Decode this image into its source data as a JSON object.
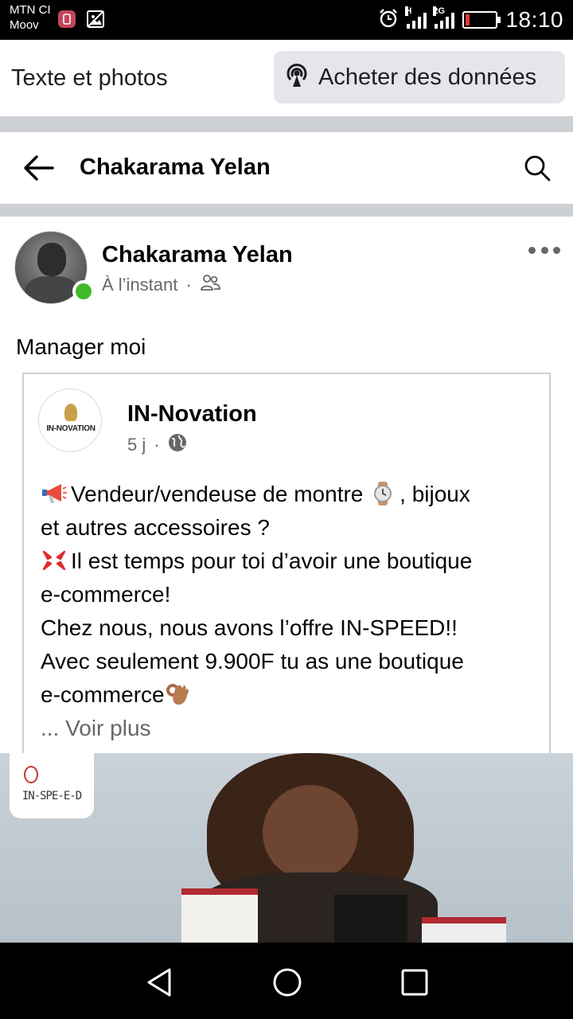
{
  "status_bar": {
    "carrier_1": "MTN CI",
    "carrier_2": "Moov",
    "network_1": "H",
    "network_2": "2G",
    "time": "18:10"
  },
  "top_bar": {
    "title": "Texte et photos",
    "buy_data_label": "Acheter des données"
  },
  "header": {
    "title": "Chakarama Yelan"
  },
  "post": {
    "author": "Chakarama Yelan",
    "time": "À l’instant",
    "separator": "·",
    "audience_icon": "friends-icon",
    "text": "Manager moi",
    "shared": {
      "page_name": "IN-Novation",
      "page_logo_text": "IN-NOVATION",
      "time": "5 j",
      "separator": "·",
      "audience_icon": "globe-icon",
      "lines": {
        "l1": "Vendeur/vendeuse de montre ",
        "l1b": ", bijoux",
        "l2": "et autres accessoires ?",
        "l3": "Il est temps pour toi d’avoir une boutique",
        "l4": "e-commerce!",
        "l5": "Chez nous, nous avons l’offre IN-SPEED!!",
        "l6": "Avec seulement 9.900F tu as une boutique",
        "l7": "e-commerce"
      },
      "see_more": "... Voir plus",
      "photo_badge": "IN-SPE-E-D"
    }
  },
  "nav": {
    "back_icon": "triangle-back-icon",
    "home_icon": "circle-home-icon",
    "recents_icon": "square-recents-icon"
  }
}
